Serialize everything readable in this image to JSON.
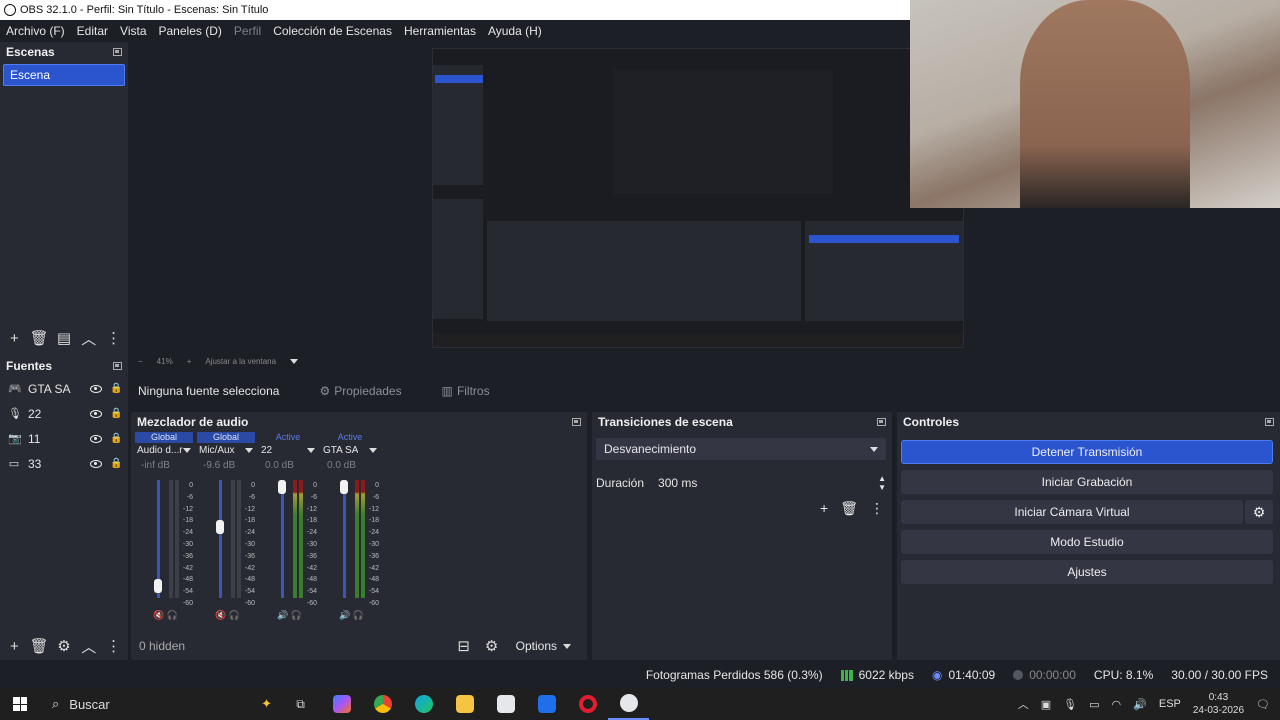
{
  "window": {
    "title": "OBS 32.1.0 - Perfil: Sin Título - Escenas: Sin Título"
  },
  "menu": [
    {
      "label": "Archivo (F)",
      "disabled": false
    },
    {
      "label": "Editar",
      "disabled": false
    },
    {
      "label": "Vista",
      "disabled": false
    },
    {
      "label": "Paneles (D)",
      "disabled": false
    },
    {
      "label": "Perfil",
      "disabled": true
    },
    {
      "label": "Colección de Escenas",
      "disabled": false
    },
    {
      "label": "Herramientas",
      "disabled": false
    },
    {
      "label": "Ayuda (H)",
      "disabled": false
    }
  ],
  "scenes": {
    "title": "Escenas",
    "items": [
      "Escena"
    ]
  },
  "sources": {
    "title": "Fuentes",
    "items": [
      {
        "label": "GTA SA",
        "icon": "gamepad-icon"
      },
      {
        "label": "22",
        "icon": "microphone-icon"
      },
      {
        "label": "11",
        "icon": "camera-icon"
      },
      {
        "label": "33",
        "icon": "monitor-icon"
      }
    ]
  },
  "preview": {
    "zoom": "41%",
    "fit_label": "Ajustar a la ventana"
  },
  "properties_bar": {
    "none_selected": "Ninguna fuente selecciona",
    "properties": "Propiedades",
    "filters": "Filtros"
  },
  "mixer": {
    "title": "Mezclador de audio",
    "channels": [
      {
        "tag": "Global",
        "name": "Audio d...ritorio",
        "db": "-inf dB",
        "fader": 0.05,
        "muted": true
      },
      {
        "tag": "Global",
        "name": "Mic/Aux",
        "db": "-9.6 dB",
        "fader": 0.62,
        "muted": true
      },
      {
        "tag": "Active",
        "name": "22",
        "db": "0.0 dB",
        "fader": 1.0,
        "muted": false
      },
      {
        "tag": "Active",
        "name": "GTA SA",
        "db": "0.0 dB",
        "fader": 1.0,
        "muted": false
      }
    ],
    "ticks": [
      "0",
      "-6",
      "-12",
      "-18",
      "-24",
      "-30",
      "-36",
      "-42",
      "-48",
      "-54",
      "-60"
    ],
    "hidden": "0 hidden",
    "options": "Options"
  },
  "transitions": {
    "title": "Transiciones de escena",
    "selected": "Desvanecimiento",
    "duration_label": "Duración",
    "duration_value": "300 ms"
  },
  "controls": {
    "title": "Controles",
    "stop_stream": "Detener Transmisión",
    "start_record": "Iniciar Grabación",
    "start_virtualcam": "Iniciar Cámara Virtual",
    "studio_mode": "Modo Estudio",
    "settings": "Ajustes"
  },
  "status": {
    "dropped": "Fotogramas Perdidos 586 (0.3%)",
    "bitrate": "6022 kbps",
    "stream_time": "01:40:09",
    "record_time": "00:00:00",
    "cpu": "CPU: 8.1%",
    "fps": "30.00 / 30.00 FPS"
  },
  "taskbar": {
    "search": "Buscar",
    "lang": "ESP",
    "time": "0:43",
    "date": "24-03-2026"
  },
  "colors": {
    "accent": "#2b55cf",
    "panel": "#272a33",
    "bg": "#1d1f26"
  }
}
